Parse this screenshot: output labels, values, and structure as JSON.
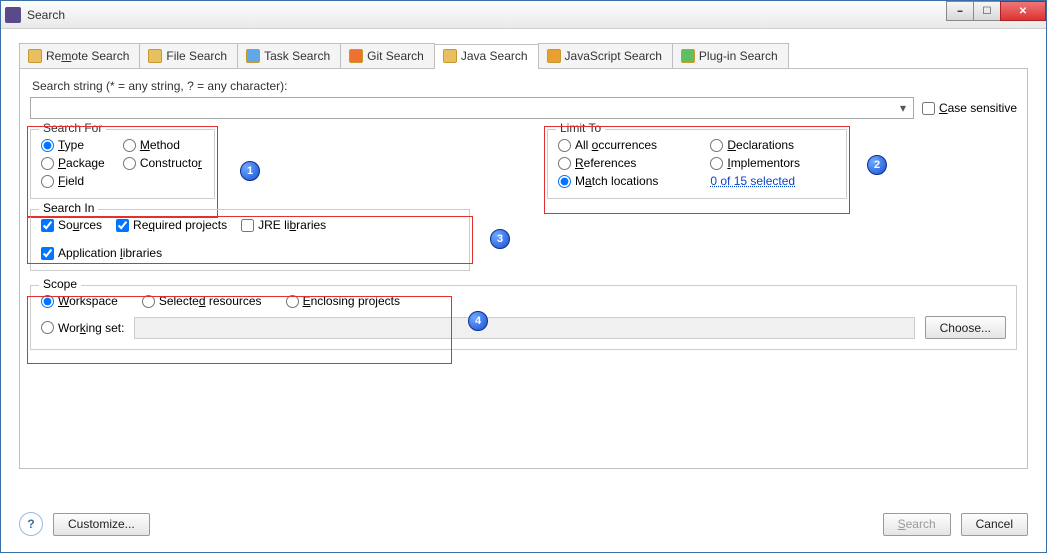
{
  "window": {
    "title": "Search"
  },
  "winbtns": {
    "min": "minimize",
    "max": "maximize",
    "close": "close"
  },
  "tabs": [
    {
      "id": "remote",
      "label": "Remote Search",
      "mnemonic": "m"
    },
    {
      "id": "file",
      "label": "File Search"
    },
    {
      "id": "task",
      "label": "Task Search"
    },
    {
      "id": "git",
      "label": "Git Search"
    },
    {
      "id": "java",
      "label": "Java Search",
      "active": true
    },
    {
      "id": "js",
      "label": "JavaScript Search"
    },
    {
      "id": "plugin",
      "label": "Plug-in Search"
    }
  ],
  "hint": "Search string (* = any string, ? = any character):",
  "search_value": "",
  "case_sensitive": {
    "label": "Case sensitive",
    "checked": false
  },
  "search_for": {
    "legend": "Search For",
    "options": [
      {
        "id": "type",
        "label": "Type",
        "checked": true
      },
      {
        "id": "method",
        "label": "Method",
        "checked": false
      },
      {
        "id": "package",
        "label": "Package",
        "checked": false
      },
      {
        "id": "constructor",
        "label": "Constructor",
        "checked": false
      },
      {
        "id": "field",
        "label": "Field",
        "checked": false
      }
    ]
  },
  "limit_to": {
    "legend": "Limit To",
    "options": [
      {
        "id": "all",
        "label": "All occurrences",
        "checked": false
      },
      {
        "id": "decl",
        "label": "Declarations",
        "checked": false
      },
      {
        "id": "ref",
        "label": "References",
        "checked": false
      },
      {
        "id": "impl",
        "label": "Implementors",
        "checked": false
      },
      {
        "id": "match",
        "label": "Match locations",
        "checked": true
      }
    ],
    "link": "0 of 15 selected"
  },
  "search_in": {
    "legend": "Search In",
    "options": [
      {
        "id": "sources",
        "label": "Sources",
        "checked": true
      },
      {
        "id": "req",
        "label": "Required projects",
        "checked": true
      },
      {
        "id": "jre",
        "label": "JRE libraries",
        "checked": false
      },
      {
        "id": "app",
        "label": "Application libraries",
        "checked": true
      }
    ]
  },
  "scope": {
    "legend": "Scope",
    "options": [
      {
        "id": "workspace",
        "label": "Workspace",
        "checked": true
      },
      {
        "id": "selres",
        "label": "Selected resources",
        "checked": false
      },
      {
        "id": "encproj",
        "label": "Enclosing projects",
        "checked": false
      },
      {
        "id": "wset",
        "label": "Working set:",
        "checked": false
      }
    ],
    "working_set_value": "",
    "choose": "Choose..."
  },
  "footer": {
    "customize": "Customize...",
    "search": "Search",
    "cancel": "Cancel"
  },
  "annotations": [
    "1",
    "2",
    "3",
    "4"
  ]
}
